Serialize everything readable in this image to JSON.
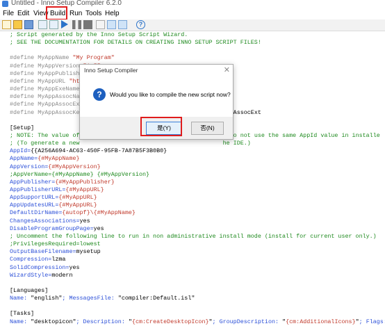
{
  "window": {
    "title": "Untitled - Inno Setup Compiler 6.2.0"
  },
  "menu": [
    "File",
    "Edit",
    "View",
    "Build",
    "Run",
    "Tools",
    "Help"
  ],
  "editor": {
    "lines": [
      {
        "parts": [
          {
            "t": "; Script generated by the Inno Setup Script Wizard.",
            "c": "comment"
          }
        ]
      },
      {
        "parts": [
          {
            "t": "; SEE THE DOCUMENTATION FOR DETAILS ON CREATING INNO SETUP SCRIPT FILES!",
            "c": "comment"
          }
        ]
      },
      {
        "parts": []
      },
      {
        "parts": [
          {
            "t": "#define MyAppName ",
            "c": "define"
          },
          {
            "t": "\"My Program\"",
            "c": "strconst"
          }
        ]
      },
      {
        "parts": [
          {
            "t": "#define MyAppVersion ",
            "c": "define"
          },
          {
            "t": "\"1.5\"",
            "c": "strconst"
          }
        ]
      },
      {
        "parts": [
          {
            "t": "#define MyAppPublisher",
            "c": "define"
          }
        ]
      },
      {
        "parts": [
          {
            "t": "#define MyAppURL ",
            "c": "define"
          },
          {
            "t": "\"ht",
            "c": "strconst"
          }
        ]
      },
      {
        "parts": [
          {
            "t": "#define MyAppExeName",
            "c": "define"
          },
          {
            "t": "                                    .exe\"",
            "c": "strconst"
          }
        ]
      },
      {
        "parts": [
          {
            "t": "#define MyAppAssocNa",
            "c": "define"
          }
        ]
      },
      {
        "parts": [
          {
            "t": "#define MyAppAssocEx",
            "c": "define"
          }
        ]
      },
      {
        "parts": [
          {
            "t": "#define MyAppAssocKe",
            "c": "define"
          },
          {
            "t": "                                        yAppAssocExt",
            "c": "text"
          }
        ]
      },
      {
        "parts": []
      },
      {
        "parts": [
          {
            "t": "[Setup]",
            "c": "section"
          }
        ]
      },
      {
        "parts": [
          {
            "t": "; NOTE: The value of",
            "c": "comment"
          },
          {
            "t": "                                         . Do not use the same AppId value in installe",
            "c": "comment"
          }
        ]
      },
      {
        "parts": [
          {
            "t": "; (To generate a new",
            "c": "comment"
          },
          {
            "t": "                                         he IDE.)",
            "c": "comment"
          }
        ]
      },
      {
        "parts": [
          {
            "t": "AppId=",
            "c": "key"
          },
          {
            "t": "{{A256A694-AC63-450F-95FB-7A87B5F3B0B0}",
            "c": "text"
          }
        ]
      },
      {
        "parts": [
          {
            "t": "AppName=",
            "c": "key"
          },
          {
            "t": "{#MyAppName}",
            "c": "strconst"
          }
        ]
      },
      {
        "parts": [
          {
            "t": "AppVersion=",
            "c": "key"
          },
          {
            "t": "{#MyAppVersion}",
            "c": "strconst"
          }
        ]
      },
      {
        "parts": [
          {
            "t": ";AppVerName={#MyAppName} {#MyAppVersion}",
            "c": "comment"
          }
        ]
      },
      {
        "parts": [
          {
            "t": "AppPublisher=",
            "c": "key"
          },
          {
            "t": "{#MyAppPublisher}",
            "c": "strconst"
          }
        ]
      },
      {
        "parts": [
          {
            "t": "AppPublisherURL=",
            "c": "key"
          },
          {
            "t": "{#MyAppURL}",
            "c": "strconst"
          }
        ]
      },
      {
        "parts": [
          {
            "t": "AppSupportURL=",
            "c": "key"
          },
          {
            "t": "{#MyAppURL}",
            "c": "strconst"
          }
        ]
      },
      {
        "parts": [
          {
            "t": "AppUpdatesURL=",
            "c": "key"
          },
          {
            "t": "{#MyAppURL}",
            "c": "strconst"
          }
        ]
      },
      {
        "parts": [
          {
            "t": "DefaultDirName=",
            "c": "key"
          },
          {
            "t": "{autopf}\\{#MyAppName}",
            "c": "strconst"
          }
        ]
      },
      {
        "parts": [
          {
            "t": "ChangesAssociations=",
            "c": "key"
          },
          {
            "t": "yes",
            "c": "text"
          }
        ]
      },
      {
        "parts": [
          {
            "t": "DisableProgramGroupPage=",
            "c": "key"
          },
          {
            "t": "yes",
            "c": "text"
          }
        ]
      },
      {
        "parts": [
          {
            "t": "; Uncomment the following line to run in non administrative install mode (install for current user only.)",
            "c": "comment"
          }
        ]
      },
      {
        "parts": [
          {
            "t": ";PrivilegesRequired=lowest",
            "c": "comment"
          }
        ]
      },
      {
        "parts": [
          {
            "t": "OutputBaseFilename=",
            "c": "key"
          },
          {
            "t": "mysetup",
            "c": "text"
          }
        ]
      },
      {
        "parts": [
          {
            "t": "Compression=",
            "c": "key"
          },
          {
            "t": "lzma",
            "c": "text"
          }
        ]
      },
      {
        "parts": [
          {
            "t": "SolidCompression=",
            "c": "key"
          },
          {
            "t": "yes",
            "c": "text"
          }
        ]
      },
      {
        "parts": [
          {
            "t": "WizardStyle=",
            "c": "key"
          },
          {
            "t": "modern",
            "c": "text"
          }
        ]
      },
      {
        "parts": []
      },
      {
        "parts": [
          {
            "t": "[Languages]",
            "c": "section"
          }
        ]
      },
      {
        "parts": [
          {
            "t": "Name: ",
            "c": "param"
          },
          {
            "t": "\"english\"",
            "c": "text"
          },
          {
            "t": "; MessagesFile: ",
            "c": "param"
          },
          {
            "t": "\"compiler:Default.isl\"",
            "c": "text"
          }
        ]
      },
      {
        "parts": []
      },
      {
        "parts": [
          {
            "t": "[Tasks]",
            "c": "section"
          }
        ]
      },
      {
        "parts": [
          {
            "t": "Name: ",
            "c": "param"
          },
          {
            "t": "\"desktopicon\"",
            "c": "text"
          },
          {
            "t": "; Description: ",
            "c": "param"
          },
          {
            "t": "\"",
            "c": "text"
          },
          {
            "t": "{cm:CreateDesktopIcon}",
            "c": "strconst"
          },
          {
            "t": "\"",
            "c": "text"
          },
          {
            "t": "; GroupDescription: ",
            "c": "param"
          },
          {
            "t": "\"",
            "c": "text"
          },
          {
            "t": "{cm:AdditionalIcons}",
            "c": "strconst"
          },
          {
            "t": "\"",
            "c": "text"
          },
          {
            "t": "; Flags:",
            "c": "param"
          }
        ]
      }
    ]
  },
  "dialog": {
    "title": "Inno Setup Compiler",
    "message": "Would you like to compile the new script now?",
    "yes_label": "是(Y)",
    "no_label": "否(N)"
  }
}
